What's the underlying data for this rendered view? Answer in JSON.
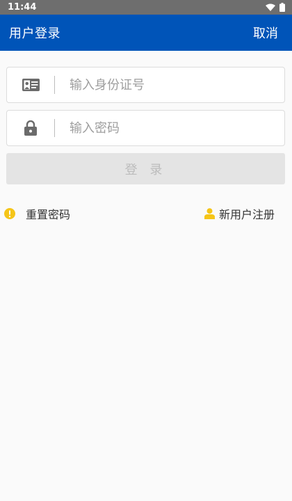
{
  "status_bar": {
    "time": "11:44",
    "wifi_icon": "wifi-icon",
    "battery_icon": "battery-icon"
  },
  "app_bar": {
    "title": "用户登录",
    "cancel": "取消",
    "color": "#0054b8"
  },
  "form": {
    "id_field": {
      "placeholder": "输入身份证号",
      "value": "",
      "icon": "id-card-icon"
    },
    "password_field": {
      "placeholder": "输入密码",
      "value": "",
      "icon": "lock-icon"
    },
    "login_button": "登 录"
  },
  "links": {
    "reset_password": {
      "label": "重置密码",
      "icon": "warning-icon",
      "icon_color": "#f5c518"
    },
    "register": {
      "label": "新用户注册",
      "icon": "user-icon",
      "icon_color": "#f5c518"
    }
  }
}
